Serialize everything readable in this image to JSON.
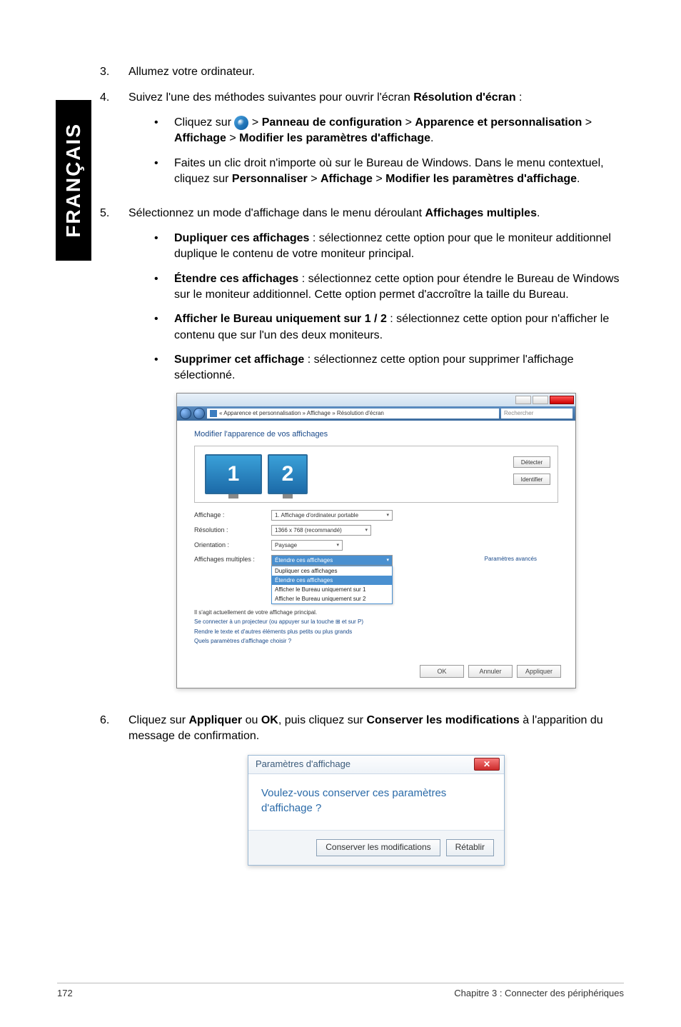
{
  "side_tab": "FRANÇAIS",
  "step3": {
    "num": "3.",
    "text": "Allumez votre ordinateur."
  },
  "step4": {
    "num": "4.",
    "intro_a": "Suivez l'une des méthodes suivantes pour ouvrir l'écran ",
    "intro_b": "Résolution d'écran",
    "intro_c": " :",
    "bullet1": {
      "a": "Cliquez sur ",
      "b": " > ",
      "p1": "Panneau de configuration",
      "p2": "Apparence et personnalisation",
      "p3": "Affichage",
      "p4": "Modifier les paramètres d'affichage",
      "gt": " > ",
      "dot": "."
    },
    "bullet2": {
      "a": "Faites un clic droit n'importe où sur le Bureau de Windows. Dans le menu contextuel, cliquez sur ",
      "p1": "Personnaliser",
      "p2": "Affichage",
      "p3": "Modifier les paramètres d'affichage",
      "gt": " > ",
      "dot": "."
    }
  },
  "step5": {
    "num": "5.",
    "intro_a": "Sélectionnez un mode d'affichage dans le menu déroulant ",
    "intro_b": "Affichages multiples",
    "intro_c": ".",
    "b1": {
      "t": "Dupliquer ces affichages",
      "d": " : sélectionnez cette option pour que le moniteur additionnel duplique le contenu de votre moniteur principal."
    },
    "b2": {
      "t": "Étendre ces affichages",
      "d": " : sélectionnez cette option pour étendre le Bureau de Windows sur le moniteur additionnel. Cette option permet d'accroître la taille du Bureau."
    },
    "b3": {
      "t": "Afficher le Bureau uniquement sur 1 / 2",
      "d": " : sélectionnez cette option pour n'afficher le contenu que sur l'un des deux moniteurs."
    },
    "b4": {
      "t": "Supprimer cet affichage",
      "d": " : sélectionnez cette option pour supprimer l'affichage sélectionné."
    }
  },
  "shot1": {
    "addr": "« Apparence et personnalisation » Affichage » Résolution d'écran",
    "search": "Rechercher",
    "header": "Modifier l'apparence de vos affichages",
    "mon1": "1",
    "mon2": "2",
    "btn_detect": "Détecter",
    "btn_identify": "Identifier",
    "rows": {
      "affichage": {
        "label": "Affichage :",
        "value": "1. Affichage d'ordinateur portable"
      },
      "resolution": {
        "label": "Résolution :",
        "value": "1366 x 768 (recommandé)"
      },
      "orientation": {
        "label": "Orientation :",
        "value": "Paysage"
      },
      "multiples": {
        "label": "Affichages multiples :",
        "value": "Étendre ces affichages"
      }
    },
    "dropdown": {
      "opt1": "Dupliquer ces affichages",
      "opt2": "Étendre ces affichages",
      "opt3": "Afficher le Bureau uniquement sur 1",
      "opt4": "Afficher le Bureau uniquement sur 2"
    },
    "link_current": "Il s'agit actuellement de votre affichage principal.",
    "link_conn": "Se connecter à un projecteur (ou appuyer sur la touche ⊞ et sur P)",
    "link_big": "Rendre le texte et d'autres éléments plus petits ou plus grands",
    "link_adv": "Quels paramètres d'affichage choisir ?",
    "param_avances": "Paramètres avancés",
    "btn_ok": "OK",
    "btn_cancel": "Annuler",
    "btn_apply": "Appliquer"
  },
  "step6": {
    "num": "6.",
    "a": "Cliquez sur ",
    "p1": "Appliquer",
    "or": " ou ",
    "p2": "OK",
    "b": ", puis cliquez sur ",
    "p3": "Conserver les modifications",
    "c": " à l'apparition du message de confirmation."
  },
  "shot2": {
    "title": "Paramètres d'affichage",
    "msg": "Voulez-vous conserver ces paramètres d'affichage ?",
    "btn_keep": "Conserver les modifications",
    "btn_revert": "Rétablir"
  },
  "footer": {
    "page": "172",
    "chapter": "Chapitre 3 : Connecter des périphériques"
  }
}
